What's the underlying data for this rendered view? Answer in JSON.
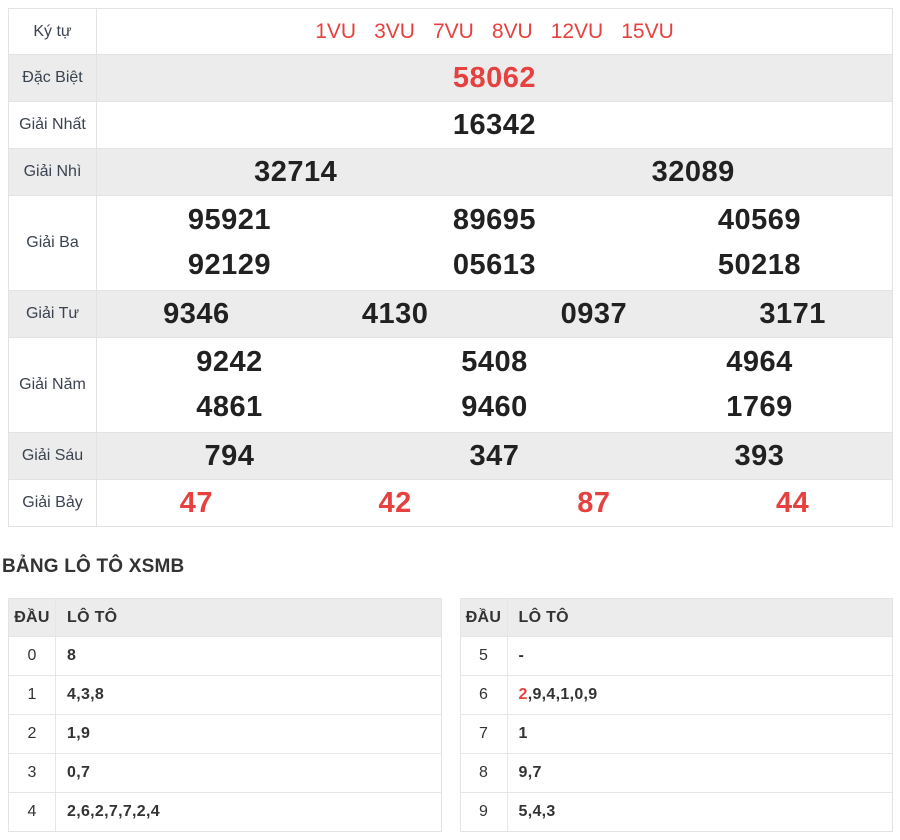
{
  "colors": {
    "accent_red": "#e6413f",
    "shaded_row_bg": "#ececec",
    "border": "#e3e3e3",
    "number_text": "#212121",
    "label_text": "#3b4350"
  },
  "results": {
    "rows": [
      {
        "label": "Ký tự",
        "symbols": true,
        "red": true,
        "cols": 6,
        "values": [
          "1VU",
          "3VU",
          "7VU",
          "8VU",
          "12VU",
          "15VU"
        ]
      },
      {
        "label": "Đặc Biệt",
        "red": true,
        "shaded": true,
        "cols": 1,
        "values": [
          "58062"
        ]
      },
      {
        "label": "Giải Nhất",
        "cols": 1,
        "values": [
          "16342"
        ]
      },
      {
        "label": "Giải Nhì",
        "shaded": true,
        "cols": 2,
        "values": [
          "32714",
          "32089"
        ]
      },
      {
        "label": "Giải Ba",
        "tall": true,
        "cols": 3,
        "values": [
          "95921",
          "89695",
          "40569",
          "92129",
          "05613",
          "50218"
        ]
      },
      {
        "label": "Giải Tư",
        "shaded": true,
        "cols": 4,
        "values": [
          "9346",
          "4130",
          "0937",
          "3171"
        ]
      },
      {
        "label": "Giải Năm",
        "tall": true,
        "cols": 3,
        "values": [
          "9242",
          "5408",
          "4964",
          "4861",
          "9460",
          "1769"
        ]
      },
      {
        "label": "Giải Sáu",
        "shaded": true,
        "cols": 3,
        "values": [
          "794",
          "347",
          "393"
        ]
      },
      {
        "label": "Giải Bảy",
        "red": true,
        "cols": 4,
        "values": [
          "47",
          "42",
          "87",
          "44"
        ]
      }
    ]
  },
  "loto": {
    "title": "BẢNG LÔ TÔ XSMB",
    "headers": [
      "ĐẦU",
      "LÔ TÔ"
    ],
    "left": [
      {
        "dau": "0",
        "values": [
          "8"
        ]
      },
      {
        "dau": "1",
        "values": [
          "4",
          "3",
          "8"
        ]
      },
      {
        "dau": "2",
        "values": [
          "1",
          "9"
        ]
      },
      {
        "dau": "3",
        "values": [
          "0",
          "7"
        ]
      },
      {
        "dau": "4",
        "values": [
          "2",
          "6",
          "2",
          "7",
          "7",
          "2",
          "4"
        ]
      }
    ],
    "right": [
      {
        "dau": "5",
        "values": [
          "-"
        ]
      },
      {
        "dau": "6",
        "values": [
          "2",
          "9",
          "4",
          "1",
          "0",
          "9"
        ],
        "red_indices": [
          0
        ]
      },
      {
        "dau": "7",
        "values": [
          "1"
        ]
      },
      {
        "dau": "8",
        "values": [
          "9",
          "7"
        ]
      },
      {
        "dau": "9",
        "values": [
          "5",
          "4",
          "3"
        ]
      }
    ]
  }
}
